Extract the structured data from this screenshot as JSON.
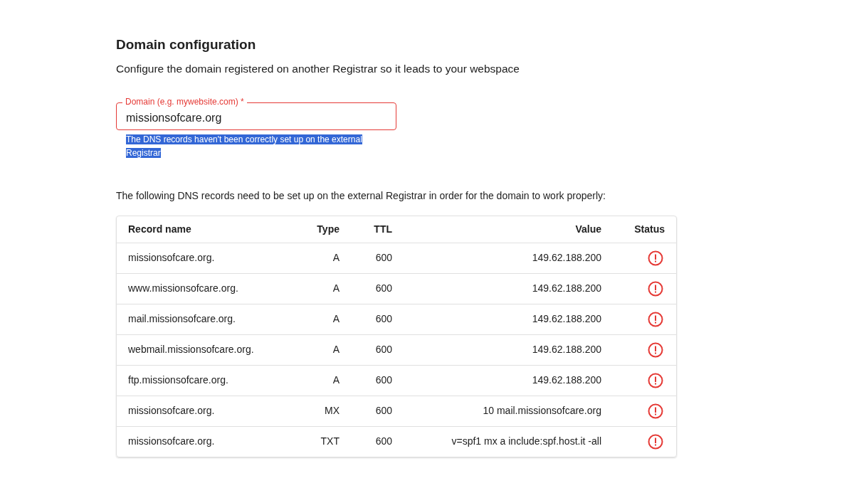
{
  "title": "Domain configuration",
  "subtitle": "Configure the domain registered on another Registrar so it leads to your webspace",
  "domain_field": {
    "label": "Domain (e.g. mywebsite.com) *",
    "value": "missionsofcare.org",
    "invalid": true,
    "helper_text": "The DNS records haven't been correctly set up on the external Registrar",
    "helper_selected": true
  },
  "intro": "The following DNS records need to be set up on the external Registrar in order for the domain to work properly:",
  "table": {
    "columns": [
      "Record name",
      "Type",
      "TTL",
      "Value",
      "Status"
    ],
    "rows": [
      {
        "name": "missionsofcare.org.",
        "type": "A",
        "ttl": "600",
        "value": "149.62.188.200",
        "failed": true
      },
      {
        "name": "www.missionsofcare.org.",
        "type": "A",
        "ttl": "600",
        "value": "149.62.188.200",
        "failed": true
      },
      {
        "name": "mail.missionsofcare.org.",
        "type": "A",
        "ttl": "600",
        "value": "149.62.188.200",
        "failed": true
      },
      {
        "name": "webmail.missionsofcare.org.",
        "type": "A",
        "ttl": "600",
        "value": "149.62.188.200",
        "failed": true
      },
      {
        "name": "ftp.missionsofcare.org.",
        "type": "A",
        "ttl": "600",
        "value": "149.62.188.200",
        "failed": true
      },
      {
        "name": "missionsofcare.org.",
        "type": "MX",
        "ttl": "600",
        "value": "10 mail.missionsofcare.org",
        "failed": true
      },
      {
        "name": "missionsofcare.org.",
        "type": "TXT",
        "ttl": "600",
        "value": "v=spf1 mx a include:spf.host.it -all",
        "failed": true
      }
    ]
  }
}
